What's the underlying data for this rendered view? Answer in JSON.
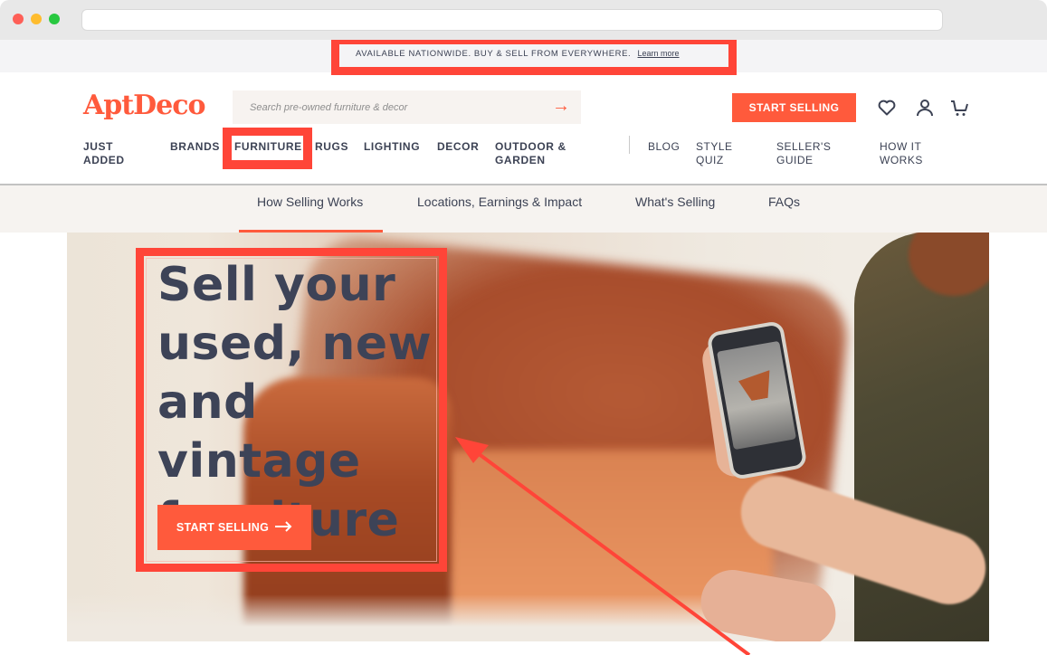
{
  "browser": {
    "url": ""
  },
  "promo": {
    "text": "AVAILABLE NATIONWIDE. BUY & SELL FROM EVERYWHERE.",
    "link": "Learn more"
  },
  "header": {
    "logo": "AptDeco",
    "search_placeholder": "Search pre-owned furniture & decor",
    "search_icon": "arrow-right-icon",
    "start_selling": "START SELLING",
    "icons": [
      "heart-icon",
      "user-icon",
      "cart-icon"
    ]
  },
  "nav": {
    "primary": [
      {
        "label": "JUST\nADDED"
      },
      {
        "label": "BRANDS"
      },
      {
        "label": "FURNITURE"
      },
      {
        "label": "RUGS"
      },
      {
        "label": "LIGHTING"
      },
      {
        "label": "DECOR"
      },
      {
        "label": "OUTDOOR &\nGARDEN"
      }
    ],
    "secondary": [
      {
        "label": "BLOG"
      },
      {
        "label": "STYLE\nQUIZ"
      },
      {
        "label": "SELLER'S\nGUIDE"
      },
      {
        "label": "HOW IT\nWORKS"
      }
    ]
  },
  "subnav": {
    "items": [
      {
        "label": "How Selling Works",
        "active": true
      },
      {
        "label": "Locations, Earnings & Impact",
        "active": false
      },
      {
        "label": "What's Selling",
        "active": false
      },
      {
        "label": "FAQs",
        "active": false
      }
    ]
  },
  "hero": {
    "title": "Sell your used, new and vintage furniture",
    "cta": "START SELLING",
    "cta_icon": "arrow-right-icon"
  },
  "colors": {
    "brand": "#ff5a3c",
    "text_dark": "#3d4357",
    "annotation": "#ff4538"
  }
}
